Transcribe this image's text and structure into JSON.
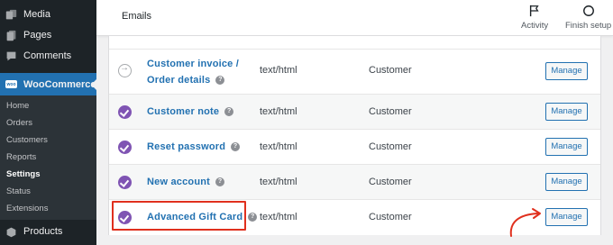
{
  "sidebar": {
    "items": [
      {
        "label": "Media",
        "icon": "media-icon"
      },
      {
        "label": "Pages",
        "icon": "pages-icon"
      },
      {
        "label": "Comments",
        "icon": "comments-icon"
      }
    ],
    "woocommerce": {
      "label": "WooCommerce",
      "badge": "woo"
    },
    "submenu": [
      "Home",
      "Orders",
      "Customers",
      "Reports",
      "Settings",
      "Status",
      "Extensions"
    ],
    "current_submenu": "Settings",
    "products": {
      "label": "Products",
      "icon": "products-icon"
    }
  },
  "header": {
    "title": "Emails",
    "activity_label": "Activity",
    "finish_setup_label": "Finish setup"
  },
  "emails": [
    {
      "name_line1": "Customer invoice /",
      "name_line2": "Order details",
      "content_type": "text/html",
      "recipient": "Customer",
      "manage_label": "Manage",
      "status": "manual"
    },
    {
      "name": "Customer note",
      "content_type": "text/html",
      "recipient": "Customer",
      "manage_label": "Manage",
      "status": "enabled"
    },
    {
      "name": "Reset password",
      "content_type": "text/html",
      "recipient": "Customer",
      "manage_label": "Manage",
      "status": "enabled"
    },
    {
      "name": "New account",
      "content_type": "text/html",
      "recipient": "Customer",
      "manage_label": "Manage",
      "status": "enabled"
    },
    {
      "name": "Advanced Gift Card",
      "content_type": "text/html",
      "recipient": "Customer",
      "manage_label": "Manage",
      "status": "enabled"
    }
  ],
  "help_glyph": "?",
  "colors": {
    "accent": "#2271b1",
    "enabled": "#7f54b3",
    "highlight": "#e0301e",
    "sidebar": "#1d2327"
  }
}
